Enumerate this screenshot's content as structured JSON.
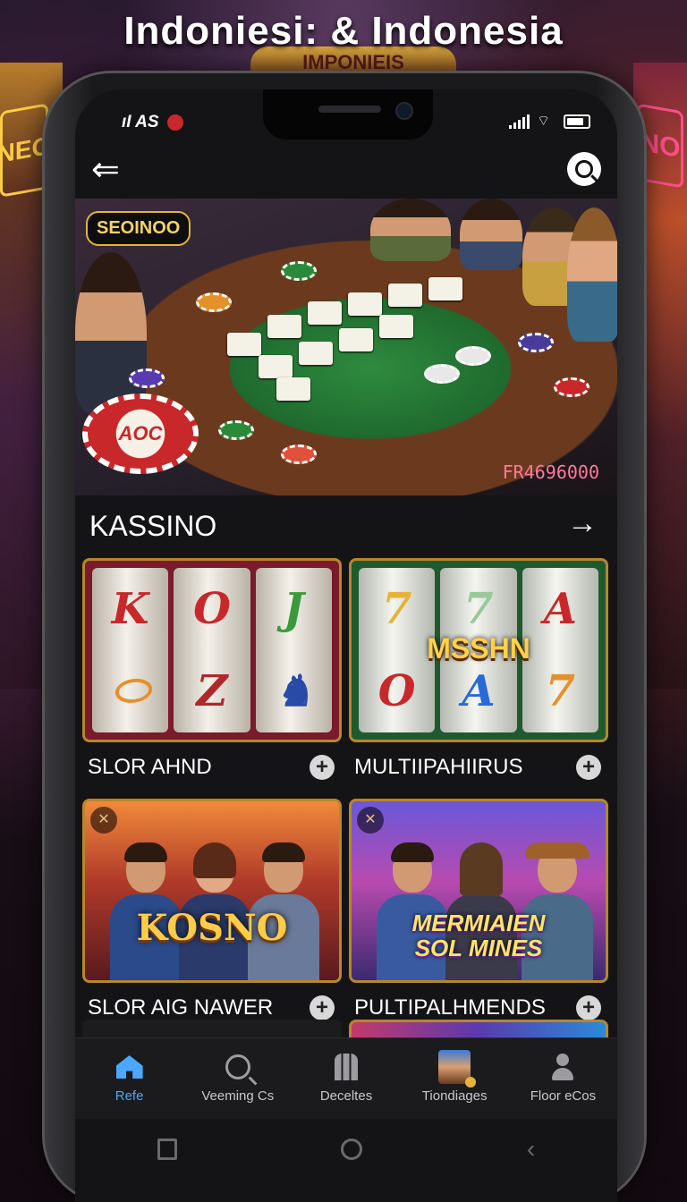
{
  "headline": "Indoniesi: & Indonesia",
  "background": {
    "left_sign": "NEO",
    "right_sign": "NO",
    "back_sign": "IMPONIEIS"
  },
  "status_bar": {
    "carrier": "AS",
    "carrier_prefix": "ıI"
  },
  "top_bar": {
    "back_icon": "arrow-left-icon",
    "search_icon": "search-icon"
  },
  "hero": {
    "badge": "SEOINOO",
    "chip_label": "AOC",
    "jackpot": "FR4696000"
  },
  "section": {
    "title": "KASSINO",
    "arrow": "→"
  },
  "tiles": [
    {
      "label": "SLOR AHND",
      "reels": [
        "K",
        "O",
        "J",
        "⬭",
        "Z",
        "♞"
      ]
    },
    {
      "label": "MULTIIPAHIIRUS",
      "overlay": "MSSHN",
      "reels": [
        "7",
        "7",
        "A",
        "O",
        "A",
        "7"
      ]
    },
    {
      "label": "SLOR AIG NAWER",
      "logo": "KOSNO"
    },
    {
      "label": "PULTIPALHMENDS",
      "logo_line1": "MERMIAIEN",
      "logo_line2": "SOL MINES"
    }
  ],
  "tabbar": [
    {
      "label": "Refe",
      "icon": "home-icon",
      "active": true
    },
    {
      "label": "Veeming Cs",
      "icon": "search-icon",
      "active": false
    },
    {
      "label": "Deceltes",
      "icon": "building-icon",
      "active": false
    },
    {
      "label": "Tiondiages",
      "icon": "avatar-thumbnail-icon",
      "active": false
    },
    {
      "label": "Floor eCos",
      "icon": "profile-icon",
      "active": false
    }
  ],
  "colors": {
    "accent": "#4aa8ff",
    "gold": "#e6b23a",
    "jackpot": "#ff7a9a"
  }
}
